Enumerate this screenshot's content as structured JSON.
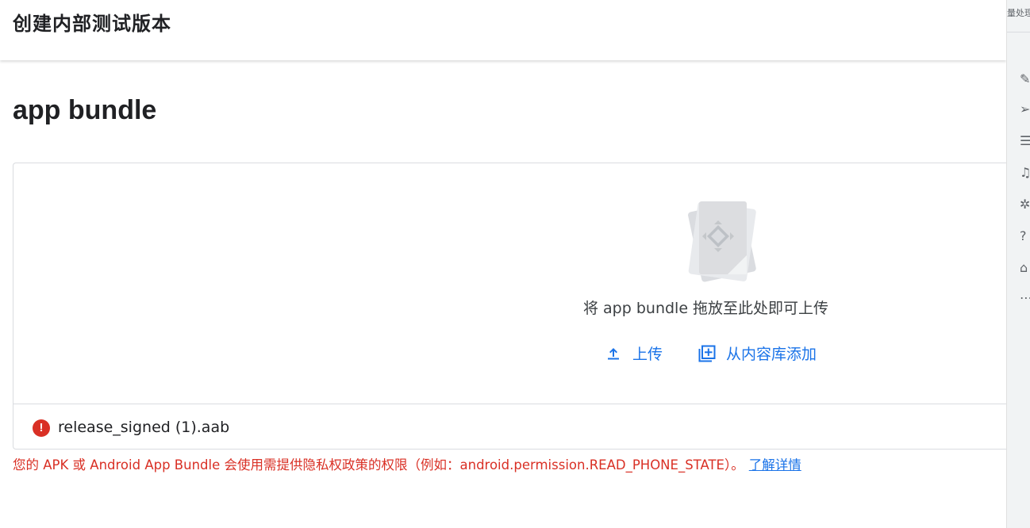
{
  "header": {
    "title": "创建内部测试版本"
  },
  "section": {
    "title": "app bundle"
  },
  "dropzone": {
    "drop_text": "将 app bundle 拖放至此处即可上传",
    "upload_label": "上传",
    "library_label": "从内容库添加"
  },
  "file": {
    "name": "release_signed (1).aab",
    "error_symbol": "!"
  },
  "error": {
    "message": "您的 APK 或 Android App Bundle 会使用需提供隐私权政策的权限（例如：android.permission.READ_PHONE_STATE）。",
    "link": "了解详情"
  },
  "right_rail": {
    "top_text": "量处理",
    "icons": [
      "edit-icon",
      "send-icon",
      "list-icon",
      "headset-icon",
      "bug-icon",
      "help-icon",
      "shirt-icon",
      "more-icon"
    ]
  },
  "footer": {
    "partial_text": ""
  },
  "colors": {
    "accent": "#1a73e8",
    "error": "#d93025",
    "text": "#202124"
  }
}
